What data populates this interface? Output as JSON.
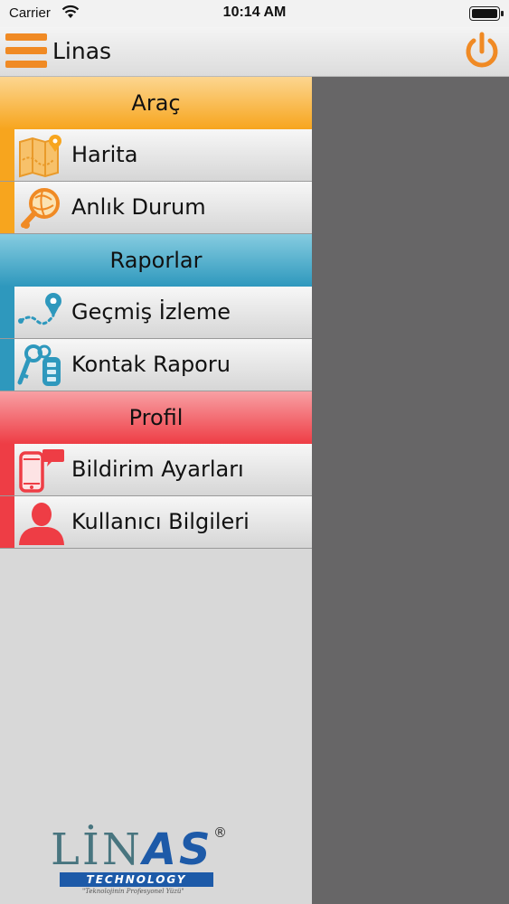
{
  "status_bar": {
    "carrier": "Carrier",
    "time": "10:14 AM",
    "battery_level": 1.0
  },
  "navbar": {
    "title": "Linas",
    "menu_icon": "hamburger-icon",
    "power_icon": "power-icon"
  },
  "colors": {
    "orange": "#f7a51e",
    "blue": "#2e98bd",
    "red": "#ee3d45",
    "overlay": "#676667"
  },
  "sections": [
    {
      "title": "Araç",
      "items": [
        {
          "label": "Harita",
          "icon": "map-icon"
        },
        {
          "label": "Anlık Durum",
          "icon": "globe-search-icon"
        }
      ]
    },
    {
      "title": "Raporlar",
      "items": [
        {
          "label": "Geçmiş İzleme",
          "icon": "route-pin-icon"
        },
        {
          "label": "Kontak Raporu",
          "icon": "car-key-icon"
        }
      ]
    },
    {
      "title": "Profil",
      "items": [
        {
          "label": "Bildirim Ayarları",
          "icon": "phone-message-icon"
        },
        {
          "label": "Kullanıcı Bilgileri",
          "icon": "user-icon"
        }
      ]
    }
  ],
  "logo": {
    "word_left": "LİN",
    "word_right": "AS",
    "registered": "®",
    "subtitle": "TECHNOLOGY",
    "tagline": "\"Teknolojinin Profesyonel Yüzü\""
  }
}
